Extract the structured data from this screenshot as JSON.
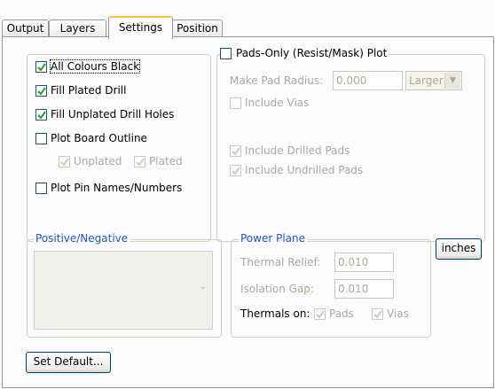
{
  "tabs": [
    {
      "label": "Output"
    },
    {
      "label": "Layers"
    },
    {
      "label": "Settings"
    },
    {
      "label": "Position"
    }
  ],
  "active_tab": "Settings",
  "options": {
    "all_colours_black": {
      "label": "All Colours Black",
      "checked": true
    },
    "fill_plated_drill": {
      "label": "Fill Plated Drill",
      "checked": true
    },
    "fill_unplated_drill_holes": {
      "label": "Fill Unplated Drill Holes",
      "checked": true
    },
    "plot_board_outline": {
      "label": "Plot Board Outline",
      "checked": false
    },
    "unplated": {
      "label": "Unplated",
      "checked": true,
      "disabled": true
    },
    "plated": {
      "label": "Plated",
      "checked": true,
      "disabled": true
    },
    "plot_pin_names": {
      "label": "Plot Pin Names/Numbers",
      "checked": false
    }
  },
  "pads_only": {
    "label": "Pads-Only (Resist/Mask) Plot",
    "checked": false,
    "make_pad_radius_label": "Make Pad Radius:",
    "make_pad_radius_value": "0.000",
    "size_select": "Larger",
    "include_vias": {
      "label": "Include Vias",
      "checked": false
    },
    "include_drilled_pads": {
      "label": "Include Drilled Pads",
      "checked": true
    },
    "include_undrilled_pads": {
      "label": "Include Undrilled Pads",
      "checked": true
    }
  },
  "positive_negative": {
    "title": "Positive/Negative"
  },
  "power_plane": {
    "title": "Power Plane",
    "thermal_relief_label": "Thermal Relief:",
    "thermal_relief_value": "0.010",
    "isolation_gap_label": "Isolation Gap:",
    "isolation_gap_value": "0.010",
    "thermals_on_label": "Thermals on:",
    "pads": {
      "label": "Pads",
      "checked": true
    },
    "vias": {
      "label": "Vias",
      "checked": true
    }
  },
  "units_button": "inches",
  "set_default_button": "Set Default...",
  "colors": {
    "title_blue": "#1e55c8",
    "tab_highlight": "#ffc83c",
    "check_green": "#21a121",
    "disabled_text": "#aca899"
  }
}
